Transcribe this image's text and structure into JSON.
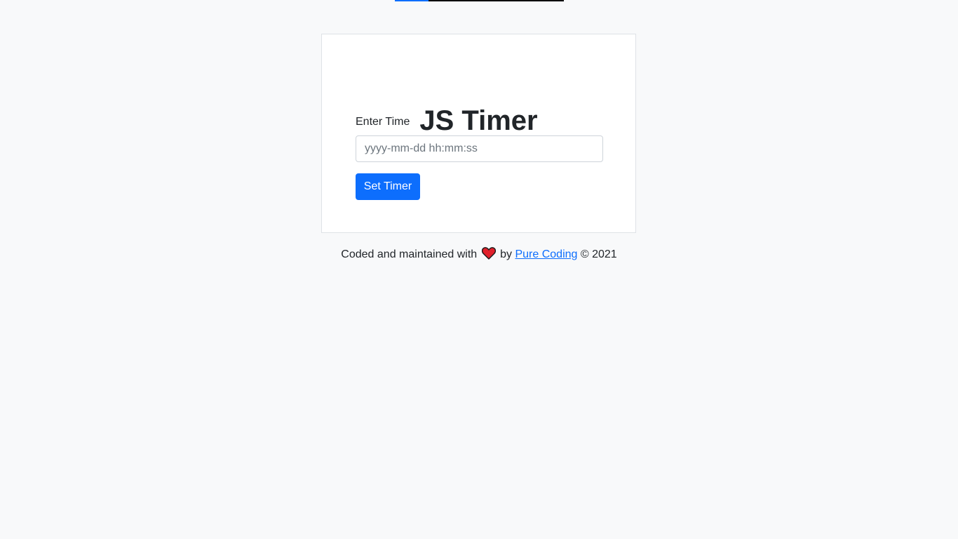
{
  "top_progress": {
    "fill_fraction": 0.2,
    "fill_color": "#0d6efd",
    "track_color": "#000000"
  },
  "card": {
    "title": "JS Timer",
    "label": "Enter Time",
    "input": {
      "placeholder": "yyyy-mm-dd hh:mm:ss",
      "value": ""
    },
    "button_label": "Set Timer"
  },
  "footer": {
    "prefix": "Coded and maintained with",
    "icon": "heart-icon",
    "by": "by",
    "link_text": "Pure Coding",
    "suffix": "© 2021"
  },
  "colors": {
    "accent": "#0d6efd",
    "background": "#f8f9fa",
    "heart": "#e0212b"
  }
}
